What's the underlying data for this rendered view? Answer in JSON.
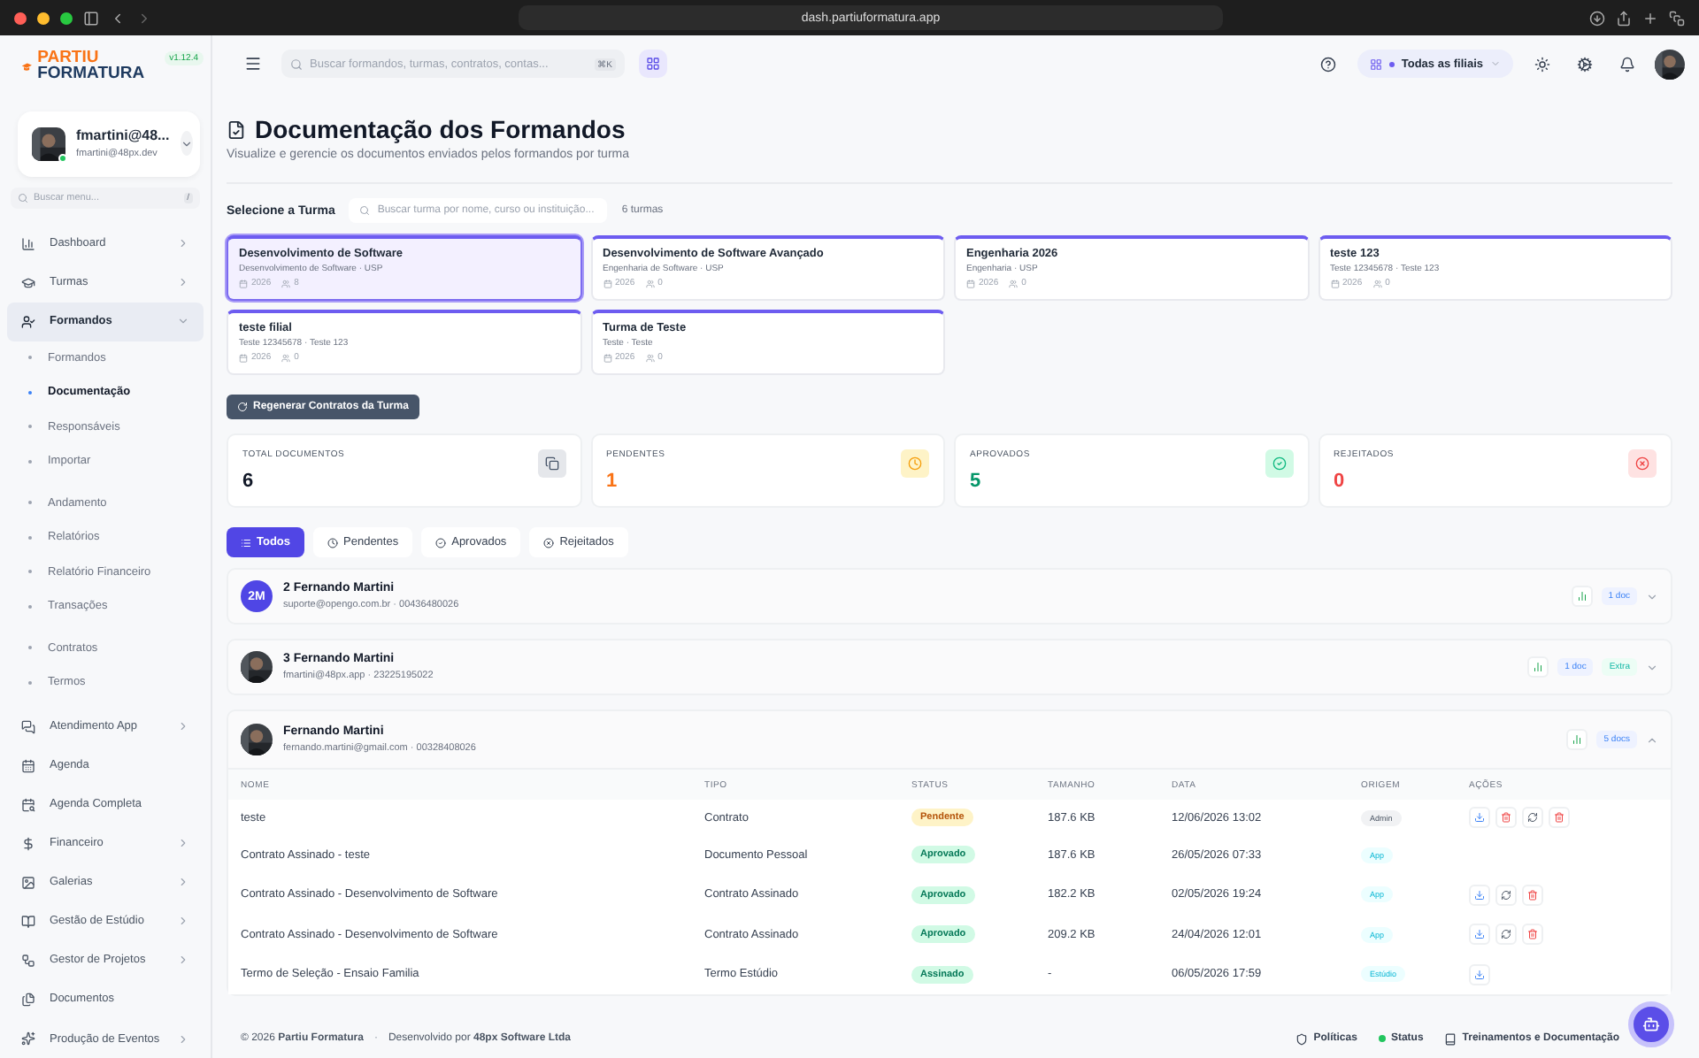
{
  "browser": {
    "url": "dash.partiuformatura.app"
  },
  "sidebar": {
    "logo": {
      "line1": "PARTIU",
      "line2": "FORMATURA"
    },
    "version": "v1.12.4",
    "user": {
      "name": "fmartini@48...",
      "email": "fmartini@48px.dev",
      "online": true
    },
    "search": {
      "placeholder": "Buscar menu...",
      "shortcut": "/"
    },
    "items": [
      {
        "label": "Dashboard",
        "expandable": true,
        "expanded": false,
        "selected": false
      },
      {
        "label": "Turmas",
        "expandable": true,
        "expanded": false,
        "selected": false
      },
      {
        "label": "Formandos",
        "expandable": true,
        "expanded": true,
        "selected": true,
        "groups": [
          [
            {
              "label": "Formandos",
              "selected": false
            },
            {
              "label": "Documentação",
              "selected": true
            },
            {
              "label": "Responsáveis",
              "selected": false
            },
            {
              "label": "Importar",
              "selected": false
            }
          ],
          [
            {
              "label": "Andamento",
              "selected": false
            },
            {
              "label": "Relatórios",
              "selected": false
            },
            {
              "label": "Relatório Financeiro",
              "selected": false
            },
            {
              "label": "Transações",
              "selected": false
            }
          ],
          [
            {
              "label": "Contratos",
              "selected": false
            },
            {
              "label": "Termos",
              "selected": false
            }
          ]
        ]
      },
      {
        "label": "Atendimento App",
        "expandable": true,
        "expanded": false,
        "selected": false
      },
      {
        "label": "Agenda",
        "expandable": false,
        "selected": false
      },
      {
        "label": "Agenda Completa",
        "expandable": false,
        "selected": false
      },
      {
        "label": "Financeiro",
        "expandable": true,
        "expanded": false,
        "selected": false
      },
      {
        "label": "Galerias",
        "expandable": true,
        "expanded": false,
        "selected": false
      },
      {
        "label": "Gestão de Estúdio",
        "expandable": true,
        "expanded": false,
        "selected": false
      },
      {
        "label": "Gestor de Projetos",
        "expandable": true,
        "expanded": false,
        "selected": false
      },
      {
        "label": "Documentos",
        "expandable": false,
        "selected": false
      },
      {
        "label": "Produção de Eventos",
        "expandable": true,
        "expanded": false,
        "selected": false
      }
    ]
  },
  "header": {
    "search": {
      "placeholder": "Buscar formandos, turmas, contratos, contas...",
      "shortcut": "⌘K"
    },
    "branch": "Todas as filiais"
  },
  "page": {
    "title": "Documentação dos Formandos",
    "subtitle": "Visualize e gerencie os documentos enviados pelos formandos por turma"
  },
  "class_picker": {
    "label": "Selecione a Turma",
    "placeholder": "Buscar turma por nome, curso ou instituição...",
    "count": "6 turmas",
    "cards": [
      {
        "title": "Desenvolvimento de Software",
        "subtitle": "Desenvolvimento de Software · USP",
        "year": "2026",
        "students": "8",
        "selected": true
      },
      {
        "title": "Desenvolvimento de Software Avançado",
        "subtitle": "Engenharia de Software · USP",
        "year": "2026",
        "students": "0",
        "selected": false
      },
      {
        "title": "Engenharia 2026",
        "subtitle": "Engenharia · USP",
        "year": "2026",
        "students": "0",
        "selected": false
      },
      {
        "title": "teste 123",
        "subtitle": "Teste 12345678 · Teste 123",
        "year": "2026",
        "students": "0",
        "selected": false
      },
      {
        "title": "teste filial",
        "subtitle": "Teste 12345678 · Teste 123",
        "year": "2026",
        "students": "0",
        "selected": false
      },
      {
        "title": "Turma de Teste",
        "subtitle": "Teste · Teste",
        "year": "2026",
        "students": "0",
        "selected": false
      }
    ]
  },
  "regenerate_button": "Regenerar Contratos da Turma",
  "stats": [
    {
      "label": "TOTAL DOCUMENTOS",
      "value": "6",
      "kind": "total"
    },
    {
      "label": "PENDENTES",
      "value": "1",
      "kind": "pending"
    },
    {
      "label": "APROVADOS",
      "value": "5",
      "kind": "approved"
    },
    {
      "label": "REJEITADOS",
      "value": "0",
      "kind": "rejected"
    }
  ],
  "filters": [
    {
      "label": "Todos",
      "kind": "all",
      "selected": true
    },
    {
      "label": "Pendentes",
      "kind": "pending",
      "selected": false
    },
    {
      "label": "Aprovados",
      "kind": "approved",
      "selected": false
    },
    {
      "label": "Rejeitados",
      "kind": "rejected",
      "selected": false
    }
  ],
  "students": [
    {
      "name": "2 Fernando Martini",
      "details": "suporte@opengo.com.br · 00436480026",
      "avatar": {
        "kind": "initials",
        "text": "2M"
      },
      "docs": "1 doc",
      "expanded": false
    },
    {
      "name": "3 Fernando Martini",
      "details": "fmartini@48px.app · 23225195022",
      "docs": "1 doc",
      "extra": "Extra",
      "expanded": false
    },
    {
      "name": "Fernando Martini",
      "details": "fernando.martini@gmail.com · 00328408026",
      "docs": "5 docs",
      "expanded": true,
      "table": {
        "columns": [
          "NOME",
          "TIPO",
          "STATUS",
          "TAMANHO",
          "DATA",
          "ORIGEM",
          "AÇÕES"
        ],
        "rows": [
          {
            "name": "teste",
            "type": "Contrato",
            "status": {
              "label": "Pendente",
              "kind": "pending"
            },
            "size": "187.6 KB",
            "date": "12/06/2026 13:02",
            "origin": {
              "label": "Admin",
              "kind": "admin"
            },
            "actions": [
              {
                "kind": "download"
              },
              {
                "kind": "delete"
              },
              {
                "kind": "regenerate"
              },
              {
                "kind": "delete"
              }
            ]
          },
          {
            "name": "Contrato Assinado - teste",
            "type": "Documento Pessoal",
            "status": {
              "label": "Aprovado",
              "kind": "approved"
            },
            "size": "187.6 KB",
            "date": "26/05/2026 07:33",
            "origin": {
              "label": "App",
              "kind": "app"
            },
            "actions": []
          },
          {
            "name": "Contrato Assinado - Desenvolvimento de Software",
            "type": "Contrato Assinado",
            "status": {
              "label": "Aprovado",
              "kind": "approved"
            },
            "size": "182.2 KB",
            "date": "02/05/2026 19:24",
            "origin": {
              "label": "App",
              "kind": "app"
            },
            "actions": [
              {
                "kind": "download"
              },
              {
                "kind": "regenerate"
              },
              {
                "kind": "delete"
              }
            ]
          },
          {
            "name": "Contrato Assinado - Desenvolvimento de Software",
            "type": "Contrato Assinado",
            "status": {
              "label": "Aprovado",
              "kind": "approved"
            },
            "size": "209.2 KB",
            "date": "24/04/2026 12:01",
            "origin": {
              "label": "App",
              "kind": "app"
            },
            "actions": [
              {
                "kind": "download"
              },
              {
                "kind": "regenerate"
              },
              {
                "kind": "delete"
              }
            ]
          },
          {
            "name": "Termo de Seleção - Ensaio Familia",
            "type": "Termo Estúdio",
            "status": {
              "label": "Assinado",
              "kind": "signed"
            },
            "size": "-",
            "date": "06/05/2026 17:59",
            "origin": {
              "label": "Estúdio",
              "kind": "studio"
            },
            "actions": [
              {
                "kind": "download"
              }
            ]
          }
        ]
      }
    }
  ],
  "footer": {
    "copyright": "© 2026 **Partiu Formatura**",
    "separator": "·",
    "credit": "Desenvolvido por **48px Software Ltda**",
    "links": [
      {
        "label": "Políticas",
        "kind": "policy"
      },
      {
        "label": "Status",
        "kind": "status"
      },
      {
        "label": "Treinamentos e Documentação",
        "kind": "docs"
      }
    ]
  }
}
